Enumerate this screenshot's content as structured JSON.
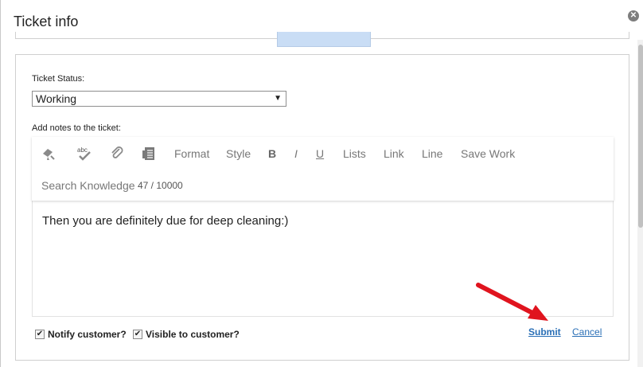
{
  "dialog": {
    "title": "Ticket info",
    "close_label": "✕"
  },
  "status": {
    "label": "Ticket Status:",
    "selected": "Working",
    "caret": "▼"
  },
  "notes": {
    "label": "Add notes to the ticket:",
    "content": "Then you are definitely due for deep cleaning:)"
  },
  "toolbar": {
    "icons": [
      "eraser-icon",
      "spellcheck-icon",
      "paperclip-icon",
      "template-icon"
    ],
    "spellcheck_text": "abc",
    "format": "Format",
    "style": "Style",
    "bold": "B",
    "italic": "I",
    "underline": "U",
    "lists": "Lists",
    "link": "Link",
    "line": "Line",
    "save_work": "Save Work",
    "search_knowledge": "Search Knowledge",
    "counter": "47 / 10000"
  },
  "footer": {
    "notify_label": "Notify customer?",
    "notify_checked": true,
    "visible_label": "Visible to customer?",
    "visible_checked": true,
    "check_mark": "✔",
    "submit": "Submit",
    "cancel": "Cancel"
  },
  "colors": {
    "link": "#2a6fb6",
    "annotation_arrow": "#e0141e",
    "tab_highlight": "#c9ddf5"
  }
}
